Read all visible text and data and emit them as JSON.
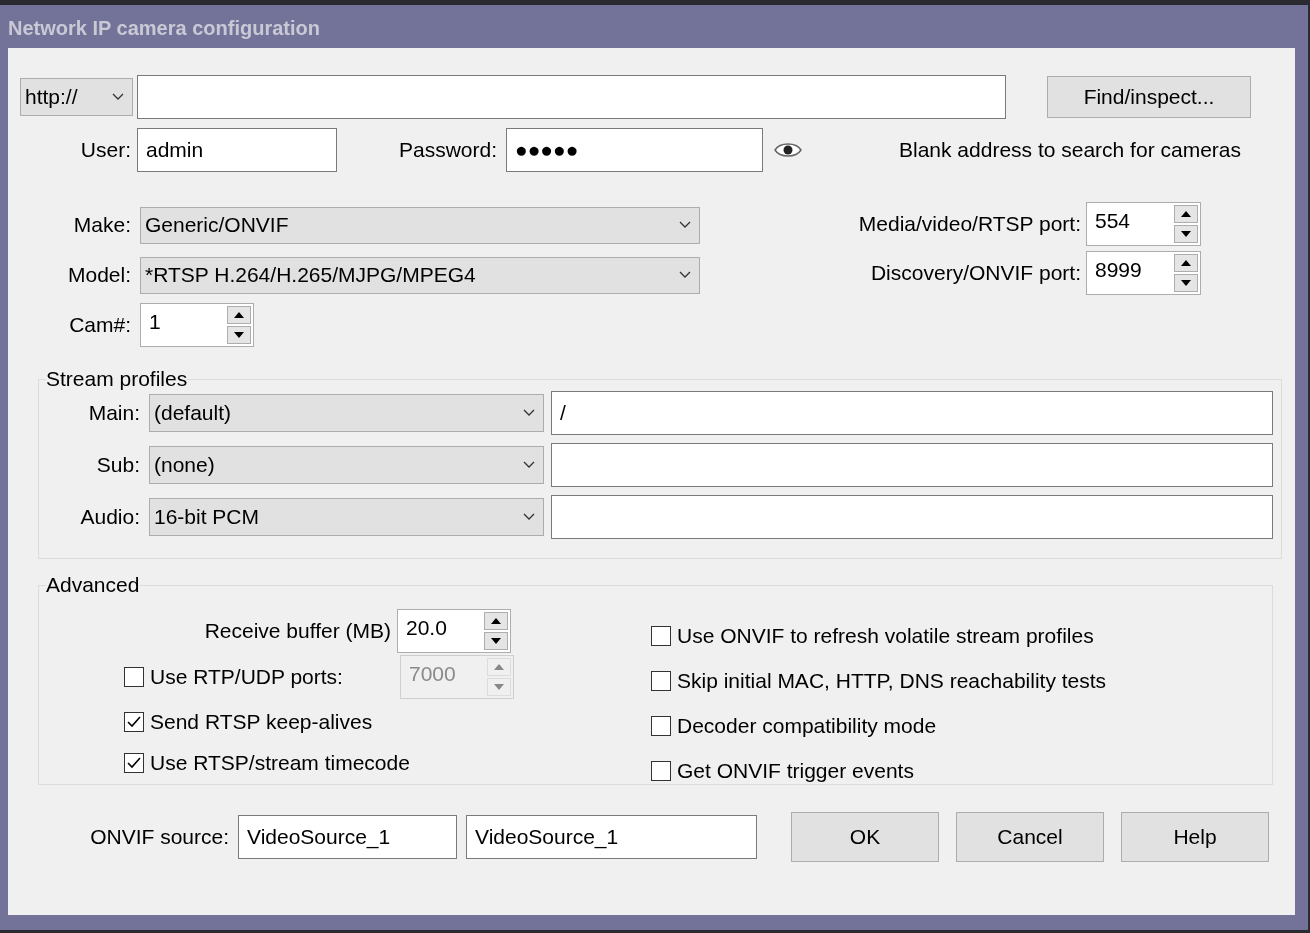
{
  "window": {
    "title": "Network IP camera configuration"
  },
  "address": {
    "scheme": "http://"
  },
  "find_button": "Find/inspect...",
  "user": {
    "label": "User:",
    "value": "admin"
  },
  "password": {
    "label": "Password:",
    "value": "●●●●●"
  },
  "hint": "Blank address to search for cameras",
  "camera": [
    {
      "label": "Make:",
      "value": "Generic/ONVIF",
      "kind": "select"
    },
    {
      "label": "Model:",
      "value": "*RTSP H.264/H.265/MJPG/MPEG4",
      "kind": "select"
    },
    {
      "label": "Cam#:",
      "value": "1",
      "kind": "spin"
    }
  ],
  "ports": [
    {
      "label": "Media/video/RTSP port:",
      "value": "554"
    },
    {
      "label": "Discovery/ONVIF port:",
      "value": "8999"
    }
  ],
  "stream_profiles": {
    "title": "Stream profiles",
    "rows": [
      {
        "label": "Main:",
        "profile": "(default)",
        "path": "/"
      },
      {
        "label": "Sub:",
        "profile": "(none)"
      },
      {
        "label": "Audio:",
        "profile": "16-bit PCM"
      }
    ]
  },
  "advanced": {
    "title": "Advanced",
    "receive_buffer": {
      "label": "Receive buffer (MB)",
      "value": "20.0"
    },
    "left_options": [
      {
        "label": "Use RTP/UDP ports:",
        "checked": false,
        "spin": {
          "value": "7000",
          "disabled": true
        }
      },
      {
        "label": "Send RTSP keep-alives",
        "checked": true
      },
      {
        "label": "Use RTSP/stream timecode",
        "checked": true
      }
    ],
    "right_options": [
      {
        "label": "Use ONVIF to refresh volatile stream profiles",
        "checked": false
      },
      {
        "label": "Skip initial MAC, HTTP, DNS reachability tests",
        "checked": false
      },
      {
        "label": "Decoder compatibility mode",
        "checked": false
      },
      {
        "label": "Get ONVIF trigger events",
        "checked": false
      }
    ]
  },
  "onvif_source": {
    "label": "ONVIF source:",
    "values": [
      "VideoSource_1",
      "VideoSource_1"
    ]
  },
  "buttons": [
    "OK",
    "Cancel",
    "Help"
  ]
}
